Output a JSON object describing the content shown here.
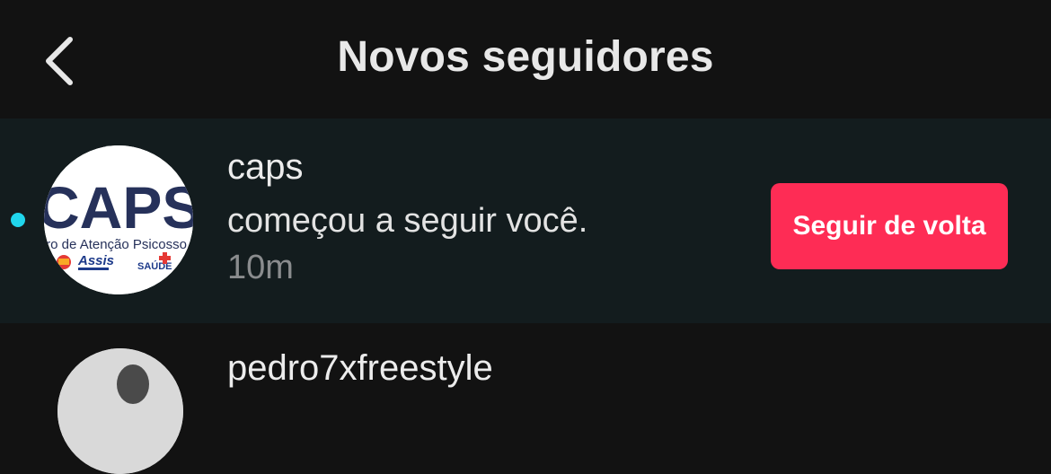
{
  "header": {
    "title": "Novos seguidores",
    "back_icon": "chevron-left-icon"
  },
  "notifications": [
    {
      "username": "caps",
      "message": "começou a seguir você.",
      "time": "10m",
      "button_label": "Seguir de volta",
      "unread": true,
      "avatar": {
        "big_text": "CAPS",
        "subtitle": "tro de Atenção Psicosso",
        "logo_left": "Assis",
        "logo_right": "SAÚDE"
      }
    },
    {
      "username": "pedro7xfreestyle"
    }
  ],
  "colors": {
    "background": "#121212",
    "highlight_row": "#131c1e",
    "unread_dot": "#20d5ec",
    "follow_button": "#fe2c55"
  }
}
